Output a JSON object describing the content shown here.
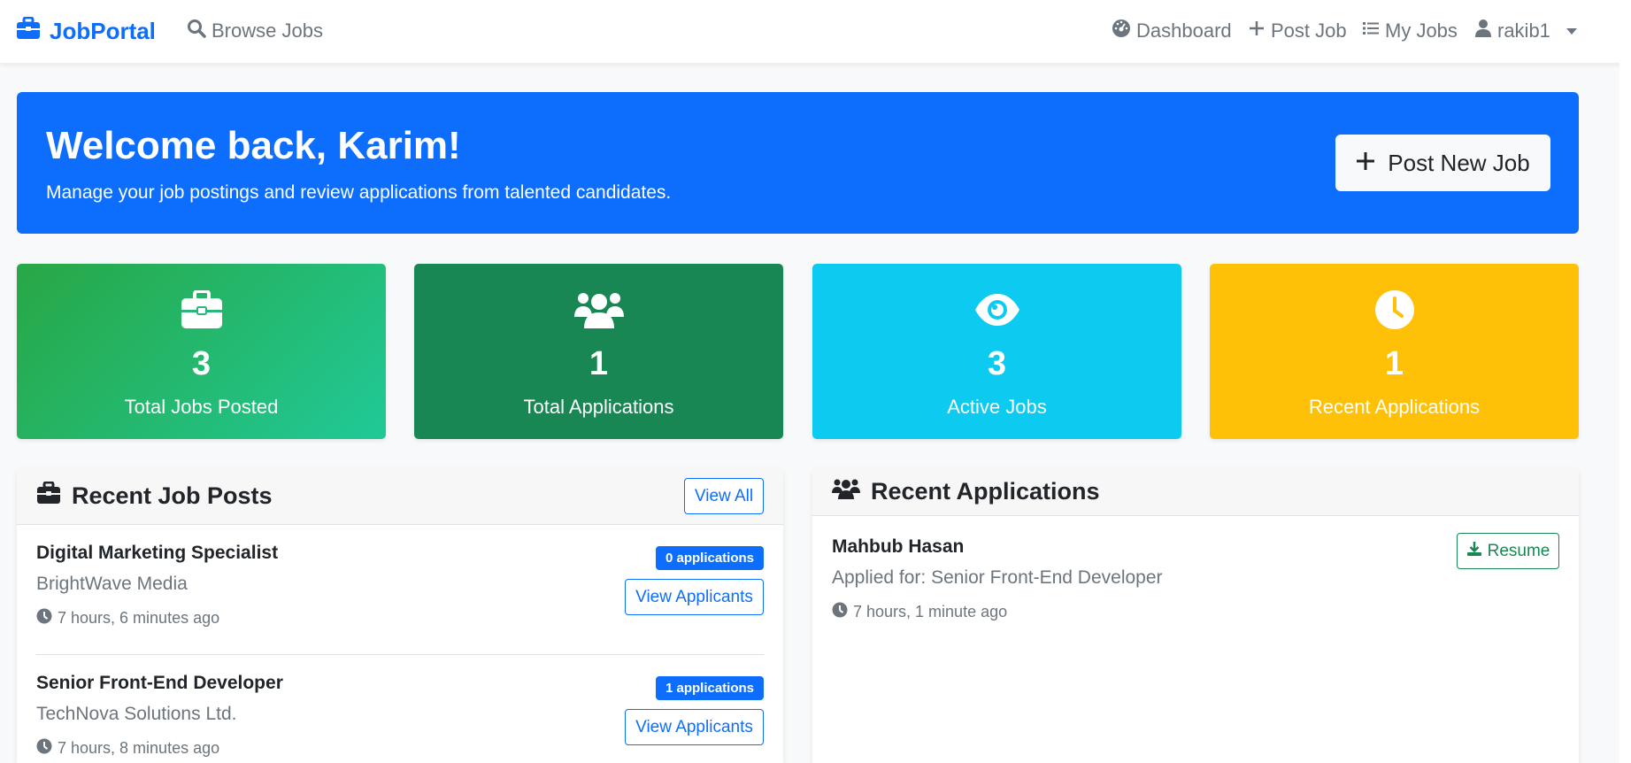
{
  "navbar": {
    "brand": "JobPortal",
    "browse": "Browse Jobs",
    "dashboard": "Dashboard",
    "post_job": "Post Job",
    "my_jobs": "My Jobs",
    "user": "rakib1"
  },
  "hero": {
    "title": "Welcome back, Karim!",
    "subtitle": "Manage your job postings and review applications from talented candidates.",
    "button": "Post New Job"
  },
  "stats": [
    {
      "icon": "briefcase-icon",
      "value": "3",
      "label": "Total Jobs Posted",
      "color": "#28a745"
    },
    {
      "icon": "users-icon",
      "value": "1",
      "label": "Total Applications",
      "color": "#198754"
    },
    {
      "icon": "eye-icon",
      "value": "3",
      "label": "Active Jobs",
      "color": "#0dcaf0"
    },
    {
      "icon": "clock-icon",
      "value": "1",
      "label": "Recent Applications",
      "color": "#ffc107"
    }
  ],
  "recent_jobs": {
    "title": "Recent Job Posts",
    "view_all": "View All",
    "items": [
      {
        "title": "Digital Marketing Specialist",
        "company": "BrightWave Media",
        "time": "7 hours, 6 minutes ago",
        "badge": "0 applications",
        "action": "View Applicants"
      },
      {
        "title": "Senior Front-End Developer",
        "company": "TechNova Solutions Ltd.",
        "time": "7 hours, 8 minutes ago",
        "badge": "1 applications",
        "action": "View Applicants"
      }
    ]
  },
  "recent_applications": {
    "title": "Recent Applications",
    "items": [
      {
        "name": "Mahbub Hasan",
        "applied_for": "Applied for: Senior Front-End Developer",
        "time": "7 hours, 1 minute ago",
        "action": "Resume"
      }
    ]
  },
  "colors": {
    "primary": "#0d6efd",
    "success": "#198754",
    "info": "#0dcaf0",
    "warning": "#ffc107",
    "muted": "#6c757d"
  }
}
